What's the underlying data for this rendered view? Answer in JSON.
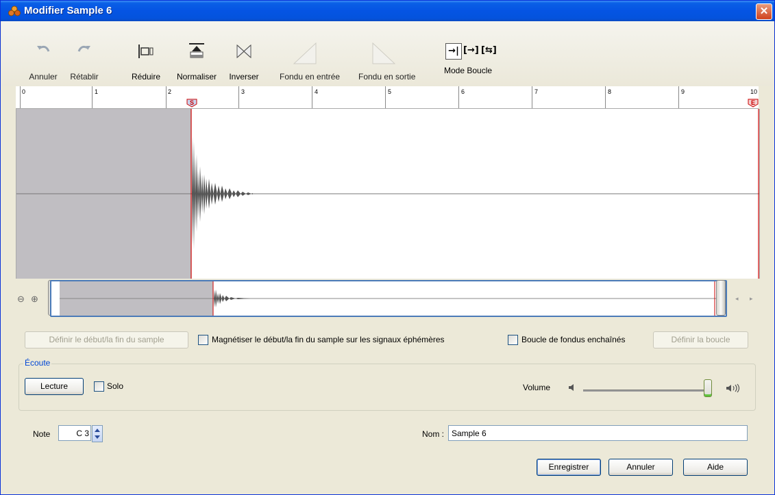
{
  "window": {
    "title": "Modifier Sample 6",
    "close_glyph": "✕"
  },
  "toolbar": {
    "undo": "Annuler",
    "redo": "Rétablir",
    "reduce": "Réduire",
    "normalize": "Normaliser",
    "invert": "Inverser",
    "fade_in": "Fondu en entrée",
    "fade_out": "Fondu en sortie",
    "mode_label": "Mode Boucle",
    "mode_buttons": [
      "→|",
      "[→]",
      "[⇆]"
    ]
  },
  "ruler": {
    "ticks": [
      "0",
      "1",
      "2",
      "3",
      "4",
      "5",
      "6",
      "7",
      "8",
      "9",
      "10"
    ],
    "start_marker": "S",
    "end_marker": "E"
  },
  "overview": {
    "zoom_out_glyph": "⊖",
    "zoom_in_glyph": "⊕",
    "left_arrow": "◂",
    "right_arrow": "▸"
  },
  "options": {
    "set_sample_bounds": "Définir le début/la fin du sample",
    "magnetize": "Magnétiser le début/la fin du sample sur les signaux éphémères",
    "crossfade_loop": "Boucle de fondus enchaînés",
    "set_loop": "Définir la boucle"
  },
  "listen": {
    "group_title": "Écoute",
    "play": "Lecture",
    "solo": "Solo",
    "volume_label": "Volume",
    "volume_level": 1.0
  },
  "note": {
    "label": "Note",
    "value": "C 3"
  },
  "name": {
    "label": "Nom :",
    "value": "Sample 6"
  },
  "footer": {
    "save": "Enregistrer",
    "cancel": "Annuler",
    "help": "Aide"
  },
  "colors": {
    "title_bar": "#0554e3",
    "selection_shade": "#c0bec2",
    "marker_red": "#cc0000",
    "accent_blue": "#0046d5"
  }
}
